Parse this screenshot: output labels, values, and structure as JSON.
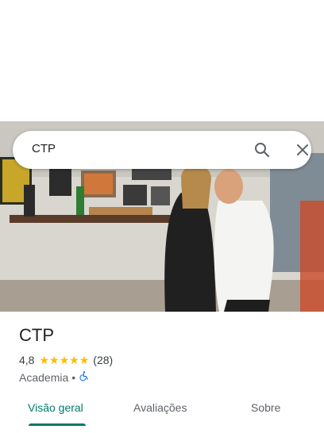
{
  "search": {
    "query": "CTP"
  },
  "place": {
    "name": "CTP",
    "rating": "4,8",
    "stars": 5,
    "review_count": "(28)",
    "category": "Academia",
    "separator": "•",
    "wheelchair_icon": "wheelchair-accessible-icon"
  },
  "tabs": [
    {
      "label": "Visão geral",
      "active": true
    },
    {
      "label": "Avaliações",
      "active": false
    },
    {
      "label": "Sobre",
      "active": false
    }
  ],
  "colors": {
    "accent": "#00796b",
    "star": "#fbbc04",
    "wheelchair": "#1a73e8"
  }
}
